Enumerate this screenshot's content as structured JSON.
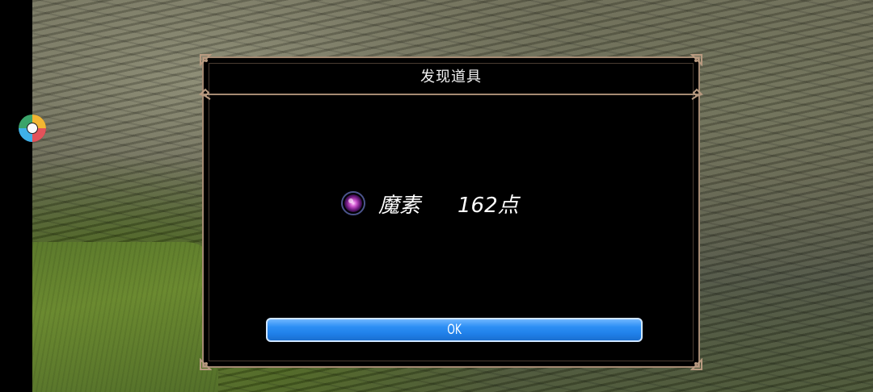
{
  "dialog": {
    "title": "发现道具",
    "item": {
      "icon": "purple-orb-icon",
      "name": "魔素",
      "amount": "162点"
    },
    "ok_label": "OK"
  },
  "colors": {
    "frame": "#a58a73",
    "dialog_bg": "#000000",
    "button": "#2d8ff5",
    "text": "#ffffff",
    "orb": "#c040c0"
  }
}
